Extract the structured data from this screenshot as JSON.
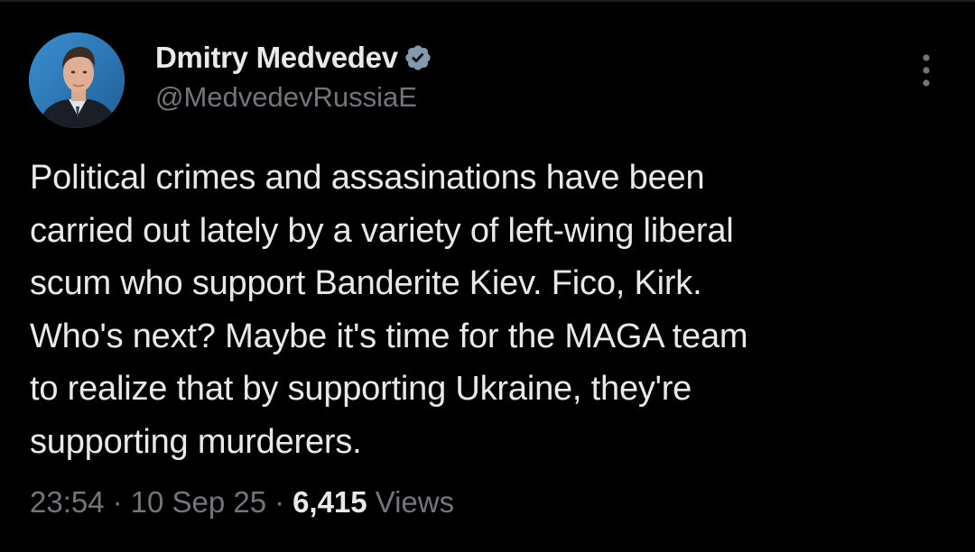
{
  "colors": {
    "background": "#000000",
    "primary_text": "#e7e9ea",
    "secondary_text": "#71767b",
    "verified_badge": "#829aab",
    "avatar_background": "#2d78b6"
  },
  "author": {
    "display_name": "Dmitry Medvedev",
    "handle": "@MedvedevRussiaE",
    "verified_icon": "verified-badge-icon",
    "avatar_icon": "profile-photo"
  },
  "tweet": {
    "text": "Political crimes and assasinations have been\ncarried out lately by a variety of left-wing liberal\nscum who support Banderite Kiev. Fico, Kirk.\nWho's next? Maybe it's time for the MAGA team\nto realize that by supporting Ukraine, they're\nsupporting murderers."
  },
  "meta": {
    "time": "23:54",
    "separator": "·",
    "date": "10 Sep 25",
    "views_count": "6,415",
    "views_label": "Views"
  },
  "menu": {
    "icon": "more-vertical-icon"
  }
}
